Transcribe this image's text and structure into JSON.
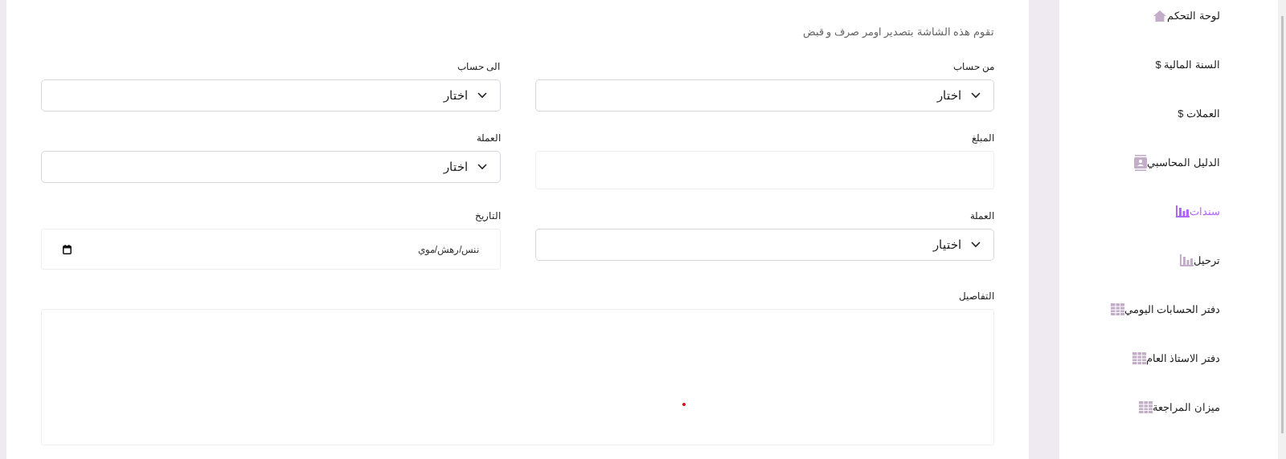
{
  "description": "تقوم هذه الشاشة بتصدير اومر صرف و قبض",
  "fields": [
    {
      "kind": "select",
      "label": "من حساب",
      "value": "اختار"
    },
    {
      "kind": "select",
      "label": "الى حساب",
      "value": "اختار"
    },
    {
      "kind": "input",
      "label": "المبلغ"
    },
    {
      "kind": "select",
      "label": "العملة",
      "value": "اختار"
    },
    {
      "kind": "select",
      "label": "العملة",
      "value": "اختيار"
    },
    {
      "kind": "date",
      "label": "التاريخ",
      "value": "ننس/رهش/موي"
    }
  ],
  "details": {
    "label": "التفاصيل"
  },
  "sidebar": {
    "items": [
      {
        "label": "لوحة التحكم",
        "kind": "home",
        "selected": false
      },
      {
        "label": "السنة المالية $",
        "kind": "plain",
        "selected": false
      },
      {
        "label": "العملات $",
        "kind": "plain",
        "selected": false
      },
      {
        "label": "الدليل المحاسبي",
        "kind": "contact",
        "selected": false
      },
      {
        "label": "سندات",
        "kind": "chart",
        "selected": true
      },
      {
        "label": "ترحيل",
        "kind": "chart",
        "selected": false
      },
      {
        "label": "دفتر الحسابات اليومي",
        "kind": "table",
        "selected": false
      },
      {
        "label": "دفتر الاستاذ العام",
        "kind": "table",
        "selected": false
      },
      {
        "label": "ميزان المراجعة",
        "kind": "table",
        "selected": false
      }
    ]
  }
}
